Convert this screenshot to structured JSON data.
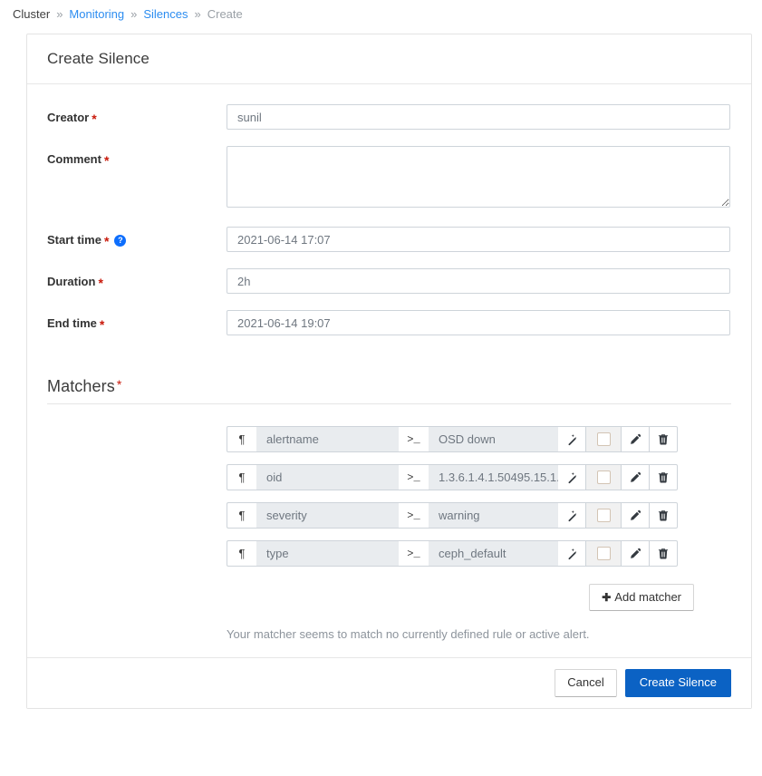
{
  "breadcrumb": {
    "items": [
      {
        "label": "Cluster",
        "type": "plain"
      },
      {
        "label": "Monitoring",
        "type": "link"
      },
      {
        "label": "Silences",
        "type": "link"
      },
      {
        "label": "Create",
        "type": "muted"
      }
    ],
    "separator": "»"
  },
  "card": {
    "title": "Create Silence"
  },
  "form": {
    "creator": {
      "label": "Creator",
      "required": "*",
      "value": "sunil",
      "placeholder": ""
    },
    "comment": {
      "label": "Comment",
      "required": "*",
      "value": "",
      "placeholder": ""
    },
    "start_time": {
      "label": "Start time",
      "required": "*",
      "help_icon": "question-circle-icon",
      "help_glyph": "?",
      "value": "2021-06-14 17:07",
      "placeholder": ""
    },
    "duration": {
      "label": "Duration",
      "required": "*",
      "value": "2h",
      "placeholder": ""
    },
    "end_time": {
      "label": "End time",
      "required": "*",
      "value": "2021-06-14 19:07",
      "placeholder": ""
    }
  },
  "matchers": {
    "title": "Matchers",
    "required": "*",
    "name_icon_glyph": "¶",
    "value_icon_glyph": ">_",
    "rows": [
      {
        "name": "alertname",
        "value": "OSD down"
      },
      {
        "name": "oid",
        "value": "1.3.6.1.4.1.50495.15.1.  ..."
      },
      {
        "name": "severity",
        "value": "warning"
      },
      {
        "name": "type",
        "value": "ceph_default"
      }
    ],
    "add_button": {
      "plus": "✚",
      "label": "Add matcher"
    },
    "note": "Your matcher seems to match no currently defined rule or active alert."
  },
  "footer": {
    "cancel_label": "Cancel",
    "submit_label": "Create Silence"
  },
  "colors": {
    "link": "#2b8cf0",
    "primary": "#0b62c4",
    "required": "#c9190b",
    "help": "#0d6efd",
    "input_border": "#ced4da",
    "disabled_bg": "#e9ecef"
  }
}
